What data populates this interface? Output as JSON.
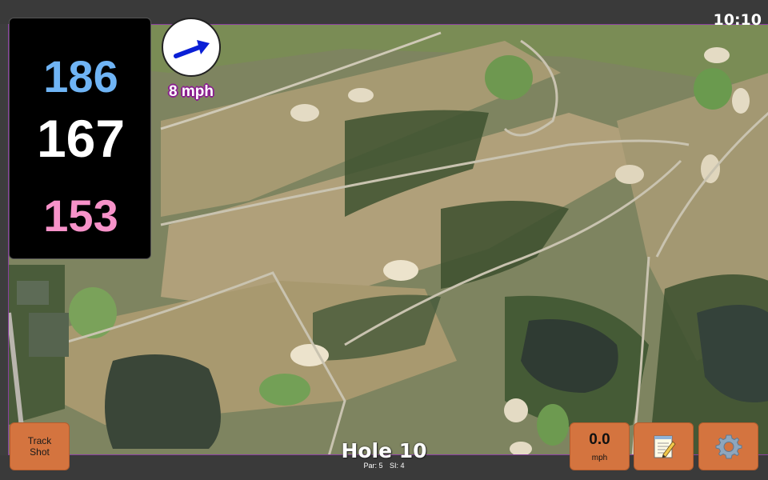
{
  "status": {
    "clock": "10:10"
  },
  "distances": {
    "back": "186",
    "middle": "167",
    "front": "153"
  },
  "wind": {
    "speed_label": "8 mph",
    "arrow_icon": "wind-arrow-icon"
  },
  "hole": {
    "title": "Hole 10",
    "par_label": "Par: 5",
    "si_label": "SI: 4"
  },
  "buttons": {
    "track_shot_line1": "Track",
    "track_shot_line2": "Shot",
    "speed_value": "0.0",
    "speed_unit": "mph",
    "notes_icon": "notepad-icon",
    "settings_icon": "gear-icon"
  },
  "colors": {
    "back_distance": "#6fb4f5",
    "middle_distance": "#ffffff",
    "front_distance": "#f792c9",
    "button_orange": "#d4743f",
    "wind_outline": "#8a1f8f"
  }
}
